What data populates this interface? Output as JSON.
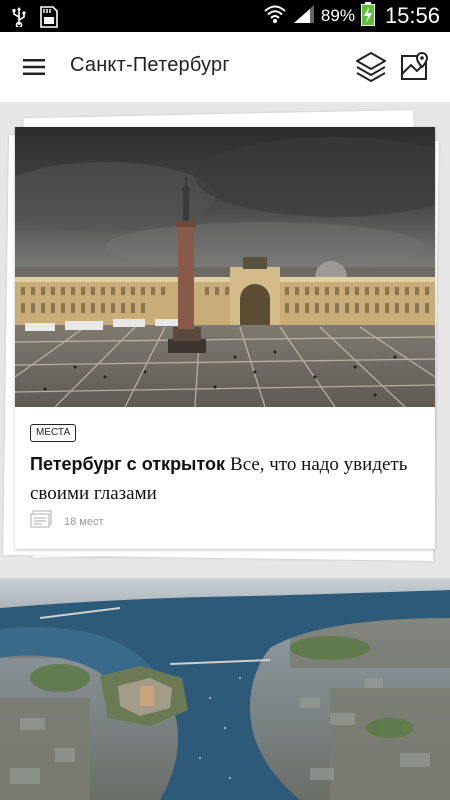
{
  "status_bar": {
    "battery_percent": "89%",
    "time": "15:56",
    "icons": [
      "usb-icon",
      "sd-card-icon",
      "wifi-icon",
      "signal-icon",
      "battery-charging-icon"
    ]
  },
  "app_bar": {
    "title": "Санкт-Петербург",
    "icons": [
      "menu-icon",
      "layers-icon",
      "map-icon"
    ]
  },
  "card": {
    "tag": "МЕСТА",
    "title_bold": "Петербург с открыток",
    "title_rest": "Все, что надо увидеть своими глазами",
    "places_count": "18 мест",
    "meta_icon": "list-icon"
  },
  "colors": {
    "status_bar_bg": "#000000",
    "app_bar_bg": "#ffffff",
    "background": "#e6e6e6"
  }
}
